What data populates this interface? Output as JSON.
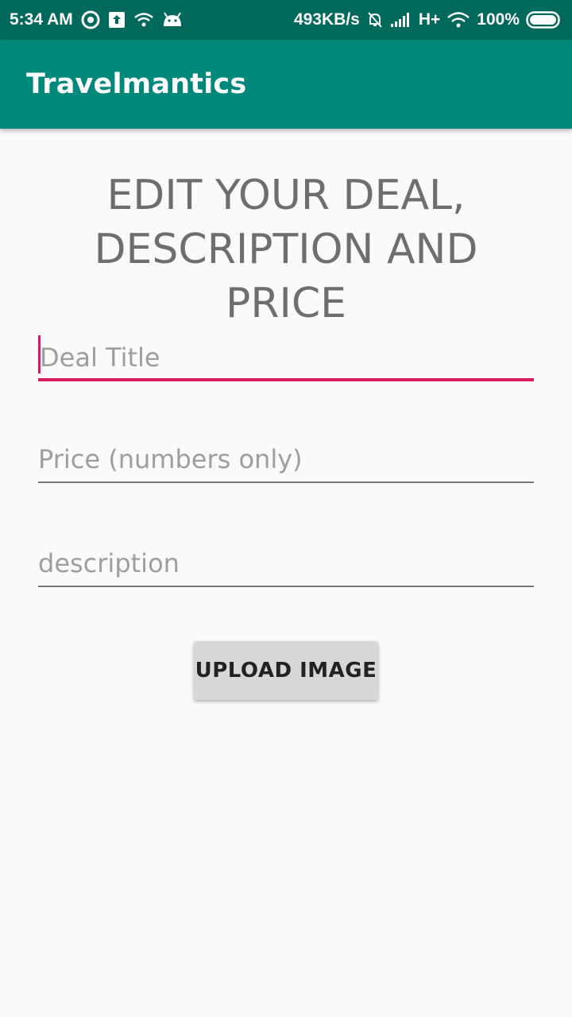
{
  "status_bar": {
    "time": "5:34 AM",
    "network_speed": "493KB/s",
    "network_type": "H+",
    "battery": "100%",
    "icons_left": [
      "chrome-icon",
      "upload-icon",
      "wifi-icon",
      "android-icon"
    ],
    "icons_right": [
      "mute-bell-icon",
      "signal-icon",
      "wifi-icon",
      "battery-icon"
    ]
  },
  "app_bar": {
    "title": "Travelmantics",
    "color": "#00897b"
  },
  "form": {
    "heading": "EDIT YOUR DEAL, DESCRIPTION AND PRICE",
    "title_placeholder": "Deal Title",
    "price_placeholder": "Price (numbers only)",
    "description_placeholder": "description",
    "upload_label": "UPLOAD IMAGE",
    "accent_color": "#d81b60"
  }
}
